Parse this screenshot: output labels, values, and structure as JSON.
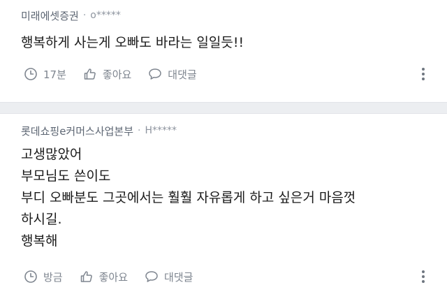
{
  "comments": [
    {
      "author": "미래에셋증권",
      "separator": "·",
      "nickname": "o*****",
      "lines": [
        "행복하게 사는게 오빠도 바라는 일일듯!!"
      ],
      "time": "17분",
      "like_label": "좋아요",
      "reply_label": "대댓글"
    },
    {
      "author": "롯데쇼핑e커머스사업본부",
      "separator": "·",
      "nickname": "H*****",
      "lines": [
        "고생많았어",
        "부모님도 쓴이도",
        "부디 오빠분도 그곳에서는 훨훨 자유롭게 하고 싶은거 마음껏",
        "하시길.",
        "행복해"
      ],
      "time": "방금",
      "like_label": "좋아요",
      "reply_label": "대댓글"
    }
  ],
  "icons": {
    "time": "clock-icon",
    "like": "thumbs-up-icon",
    "reply": "speech-bubble-icon",
    "more": "more-vertical-icon"
  },
  "colors": {
    "author": "#5d6673",
    "meta": "#8e959f",
    "icon": "#7e858f",
    "divider": "#eceef1"
  }
}
